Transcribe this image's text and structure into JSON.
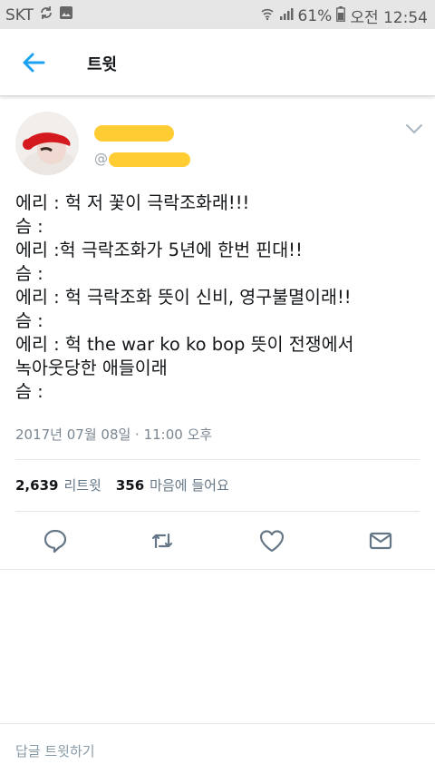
{
  "status_bar": {
    "carrier": "SKT",
    "battery": "61%",
    "time": "오전 12:54"
  },
  "header": {
    "title": "트윗"
  },
  "tweet": {
    "handle_prefix": "@",
    "lines": [
      "에리 : 헉 저 꽃이 극락조화래!!!",
      "슴 :",
      "에리 :헉 극락조화가 5년에 한번 핀대!!",
      "슴 :",
      "에리 : 헉 극락조화 뜻이 신비, 영구불멸이래!!",
      "슴 :",
      "에리 : 헉 the war ko ko bop 뜻이 전쟁에서",
      "녹아웃당한 애들이래",
      "슴 :"
    ],
    "timestamp": "2017년 07월 08일 · 11:00 오후",
    "retweet_count": "2,639",
    "retweet_label": "리트윗",
    "like_count": "356",
    "like_label": "마음에 들어요"
  },
  "reply_bar": {
    "placeholder": "답글 트윗하기"
  },
  "colors": {
    "accent": "#1da1f2",
    "redaction": "#ffcc33",
    "icon_gray": "#657786"
  }
}
